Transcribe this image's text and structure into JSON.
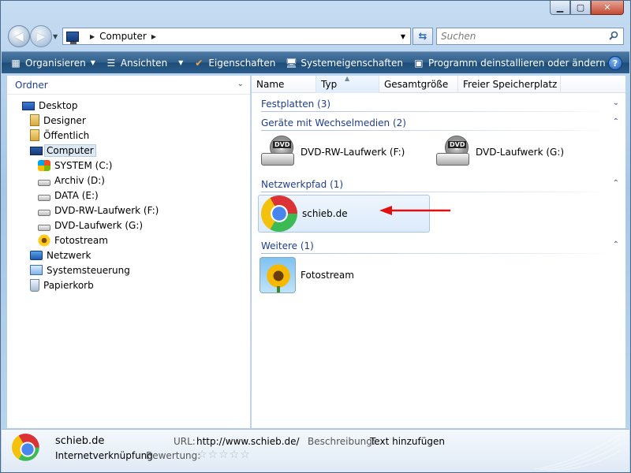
{
  "window": {
    "controls": [
      "minimize",
      "maximize",
      "close"
    ]
  },
  "address_bar": {
    "segments": [
      "Computer"
    ],
    "search_placeholder": "Suchen"
  },
  "toolbar": {
    "organize": "Organisieren",
    "views": "Ansichten",
    "properties": "Eigenschaften",
    "system_properties": "Systemeigenschaften",
    "uninstall": "Programm deinstallieren oder ändern",
    "more": "»"
  },
  "sidebar": {
    "header": "Ordner",
    "items": [
      {
        "label": "Desktop",
        "icon": "desktop-icon"
      },
      {
        "label": "Designer",
        "icon": "folder-icon"
      },
      {
        "label": "Öffentlich",
        "icon": "folder-icon"
      },
      {
        "label": "Computer",
        "icon": "computer-icon",
        "selected": true
      },
      {
        "label": "SYSTEM (C:)",
        "icon": "windows-drive-icon"
      },
      {
        "label": "Archiv (D:)",
        "icon": "drive-icon"
      },
      {
        "label": "DATA (E:)",
        "icon": "drive-icon"
      },
      {
        "label": "DVD-RW-Laufwerk (F:)",
        "icon": "dvd-drive-icon"
      },
      {
        "label": "DVD-Laufwerk (G:)",
        "icon": "dvd-drive-icon"
      },
      {
        "label": "Fotostream",
        "icon": "sunflower-icon"
      },
      {
        "label": "Netzwerk",
        "icon": "network-icon"
      },
      {
        "label": "Systemsteuerung",
        "icon": "control-panel-icon"
      },
      {
        "label": "Papierkorb",
        "icon": "recycle-bin-icon"
      }
    ]
  },
  "columns": [
    "Name",
    "Typ",
    "Gesamtgröße",
    "Freier Speicherplatz"
  ],
  "groups": {
    "hard_disks": "Festplatten (3)",
    "removable": "Geräte mit Wechselmedien (2)",
    "network": "Netzwerkpfad (1)",
    "other": "Weitere (1)"
  },
  "items": {
    "dvdrw": "DVD-RW-Laufwerk (F:)",
    "dvd": "DVD-Laufwerk (G:)",
    "schieb": "schieb.de",
    "fotostream": "Fotostream",
    "dvd_badge": "DVD"
  },
  "details": {
    "name": "schieb.de",
    "type": "Internetverknüpfung",
    "url_label": "URL:",
    "url_value": "http://www.schieb.de/",
    "desc_label": "Beschreibung:",
    "desc_value": "Text hinzufügen",
    "rating_label": "Bewertung:",
    "rating_stars": "☆☆☆☆☆"
  },
  "colors": {
    "toolbar": "#2f5f8c",
    "group_header_text": "#1e3e8c",
    "arrow": "#e01010"
  }
}
